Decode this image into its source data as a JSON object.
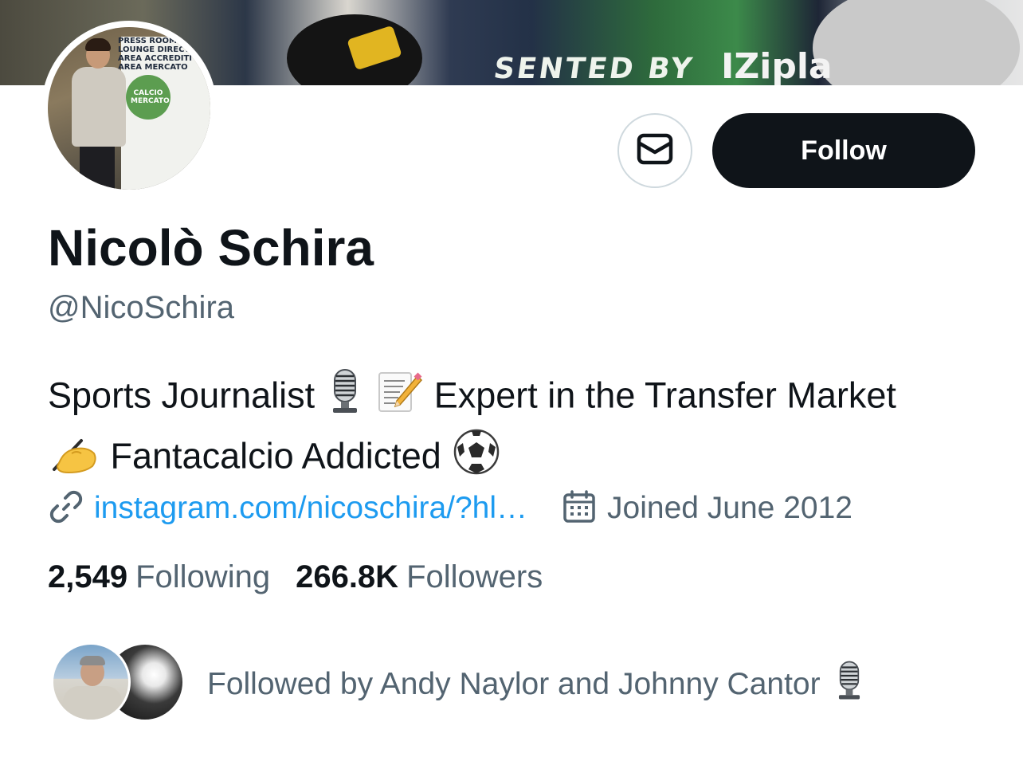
{
  "banner": {
    "text": "SENTED BY",
    "logo_text": "IZipla"
  },
  "avatar": {
    "board_text": "PRESS ROOM\nLOUNGE DIRECT\nAREA ACCREDITI\nAREA MERCATO",
    "badge_text": "CALCIO\nMERCATO"
  },
  "actions": {
    "message_icon": "envelope-icon",
    "follow_label": "Follow"
  },
  "profile": {
    "name": "Nicolò Schira",
    "handle": "@NicoSchira",
    "bio": {
      "part1": "Sports Journalist",
      "icon1": "microphone-emoji",
      "icon2": "memo-emoji",
      "part2": "Expert in the Transfer Market",
      "icon3": "writing-hand-emoji",
      "part3": "Fantacalcio Addicted",
      "icon4": "soccer-ball-emoji"
    },
    "link": "instagram.com/nicoschira/?hl…",
    "link_icon": "link-icon",
    "joined": "Joined June 2012",
    "joined_icon": "calendar-icon"
  },
  "stats": {
    "following_count": "2,549",
    "following_label": "Following",
    "followers_count": "266.8K",
    "followers_label": "Followers"
  },
  "followed_by": {
    "text": "Followed by Andy Naylor and Johnny Cantor",
    "icon": "microphone-emoji"
  },
  "colors": {
    "text_primary": "#0f1419",
    "text_secondary": "#536471",
    "link": "#1d9bf0",
    "button_bg": "#0f1419",
    "border": "#cfd9de"
  }
}
